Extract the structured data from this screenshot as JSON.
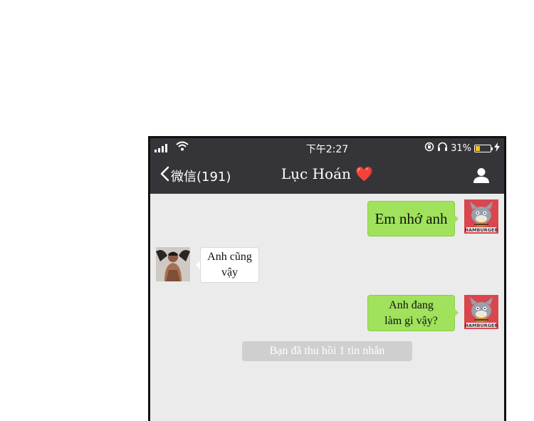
{
  "status_bar": {
    "time": "下午2:27",
    "battery": "31%",
    "battery_level": 0.31
  },
  "nav": {
    "back_label": "微信(191)",
    "contact_name": "Lục Hoán",
    "title_emoji": "❤️"
  },
  "messages": [
    {
      "from": "me",
      "text": "Em nhớ anh",
      "avatar": "tom-cat-hamburger-avatar"
    },
    {
      "from": "contact",
      "text_line1": "Anh cũng",
      "text_line2": "vậy",
      "avatar": "contact-photo-avatar"
    },
    {
      "from": "me",
      "text_line1": "Anh đang",
      "text_line2": "làm gì vậy?",
      "avatar": "tom-cat-hamburger-avatar"
    }
  ],
  "my_avatar_caption": "HAMBURGER",
  "system_notice": "Bạn đã thu hồi 1 tin nhắn",
  "colors": {
    "bar": "#353539",
    "chat_bg": "#ebebeb",
    "my_bubble": "#a0e25b",
    "their_bubble": "#ffffff",
    "heart": "#e0333b"
  }
}
